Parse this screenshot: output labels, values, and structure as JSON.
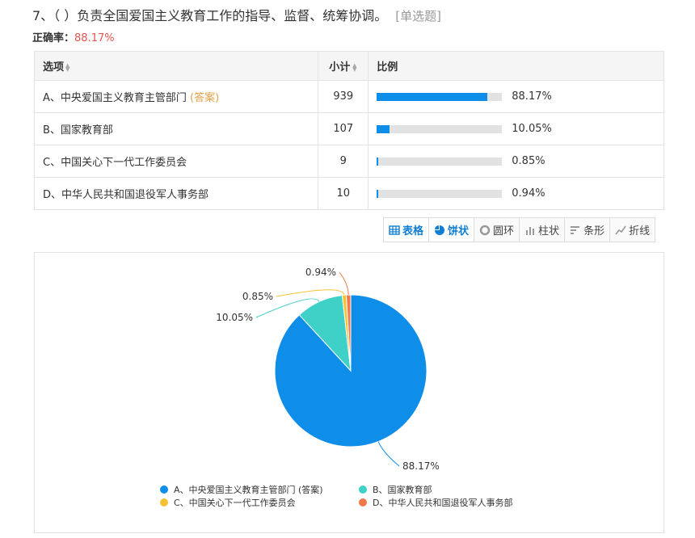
{
  "question": {
    "title": "7、（ ）负责全国爱国主义教育工作的指导、监督、统筹协调。",
    "type": "[单选题]",
    "accuracy_label": "正确率：",
    "accuracy_value": "88.17%"
  },
  "table": {
    "headers": {
      "option": "选项",
      "count": "小计",
      "ratio": "比例"
    },
    "sort_icon": "sort-icon",
    "rows": [
      {
        "option": "A、中央爱国主义教育主管部门",
        "answer_tag": "(答案)",
        "count": "939",
        "percent": "88.17%",
        "fraction": 0.8817
      },
      {
        "option": "B、国家教育部",
        "answer_tag": "",
        "count": "107",
        "percent": "10.05%",
        "fraction": 0.1005
      },
      {
        "option": "C、中国关心下一代工作委员会",
        "answer_tag": "",
        "count": "9",
        "percent": "0.85%",
        "fraction": 0.0085
      },
      {
        "option": "D、中华人民共和国退役军人事务部",
        "answer_tag": "",
        "count": "10",
        "percent": "0.94%",
        "fraction": 0.0094
      }
    ]
  },
  "toolbar": {
    "buttons": [
      {
        "label": "表格",
        "icon": "table-icon",
        "active": true
      },
      {
        "label": "饼状",
        "icon": "pie-icon",
        "active": true
      },
      {
        "label": "圆环",
        "icon": "ring-icon",
        "active": false
      },
      {
        "label": "柱状",
        "icon": "column-icon",
        "active": false
      },
      {
        "label": "条形",
        "icon": "bar-icon",
        "active": false
      },
      {
        "label": "折线",
        "icon": "line-icon",
        "active": false
      }
    ]
  },
  "chart_data": {
    "type": "pie",
    "categories": [
      "A、中央爱国主义教育主管部门 (答案)",
      "B、国家教育部",
      "C、中国关心下一代工作委员会",
      "D、中华人民共和国退役军人事务部"
    ],
    "values": [
      88.17,
      10.05,
      0.85,
      0.94
    ],
    "data_labels": [
      "88.17%",
      "10.05%",
      "0.85%",
      "0.94%"
    ],
    "colors": [
      "#0e8ee8",
      "#3fd0c7",
      "#f6c234",
      "#f0784a"
    ],
    "legend": "bottom"
  }
}
